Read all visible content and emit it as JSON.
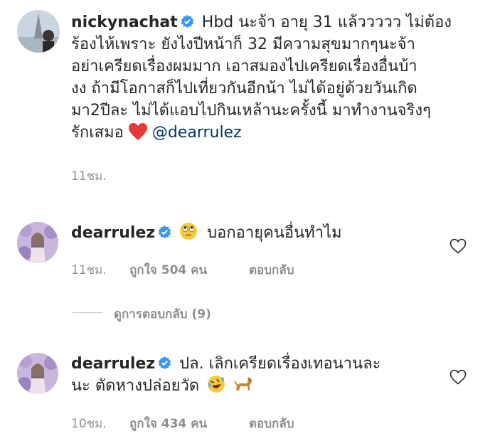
{
  "post": {
    "username": "nickynachat",
    "caption_lines": [
      "Hbd นะจ้า อายุ 31 แล้ววววว ไม่ต้อง",
      "ร้องไห้เพราะ ยังไงปีหน้าก็ 32 มีความสุขมากๆนะจ้า",
      "อย่าเครียดเรื่องผมมาก เอาสมองไปเครียดเรื่องอื่นบ้า",
      "งง ถ้ามีโอกาสก็ไปเที่ยวกันอีกน้า ไม่ได้อยู่ด้วยวันเกิด",
      "มา2ปีละ ไม่ได้แอบไปกินเหล้านะครั้งนี้ มาทำงานจริงๆ",
      "รักเสมอ"
    ],
    "mention": "@dearrulez",
    "time": "11ชม."
  },
  "replies": [
    {
      "username": "dearrulez",
      "text": "บอกอายุคนอื่นทำไม",
      "time": "11ชม.",
      "likes": "ถูกใจ 504 คน",
      "reply_label": "ตอบกลับ"
    },
    {
      "username": "dearrulez",
      "text_line1": "ปล. เลิกเครียดเรื่องเทอนานละ",
      "text_line2": "นะ ตัดหางปล่อยวัด",
      "time": "10ชม.",
      "likes": "ถูกใจ 434 คน",
      "reply_label": "ตอบกลับ"
    }
  ],
  "view_replies": "ดูการตอบกลับ (9)",
  "colors": {
    "text": "#262626",
    "muted": "#8e8e8e",
    "verified": "#3897f0",
    "mention": "#00376b"
  },
  "icons": [
    "verified-badge-icon",
    "heart-emoji-icon",
    "eye-roll-emoji-icon",
    "laughing-emoji-icon",
    "dog-emoji-icon",
    "like-heart-icon"
  ]
}
